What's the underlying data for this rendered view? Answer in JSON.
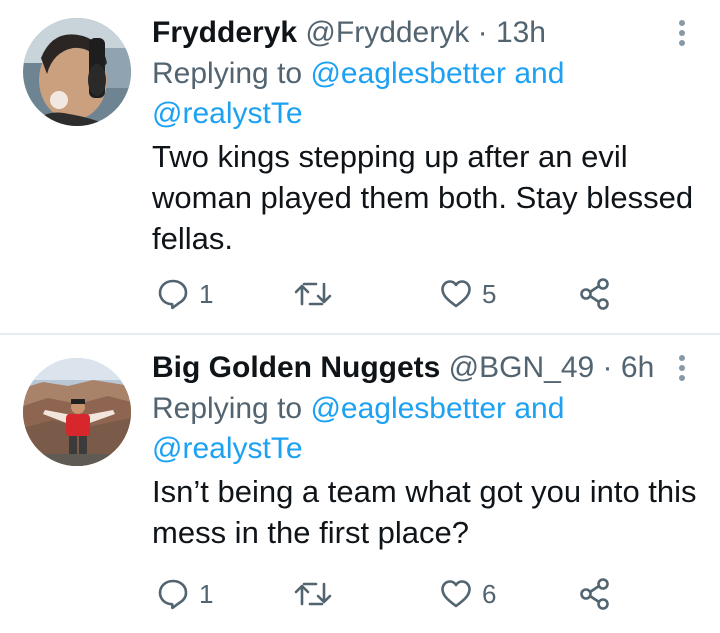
{
  "tweets": [
    {
      "name": "Frydderyk",
      "handle": "@Frydderyk",
      "separator": "·",
      "time": "13h",
      "replying_prefix": "Replying to",
      "mention_1": "@eaglesbetter",
      "and_text": "and",
      "mention_2": "@realystTe",
      "text": "Two kings stepping up after an evil woman played them both. Stay blessed fellas.",
      "reply_count": "1",
      "retweet_count": "",
      "like_count": "5"
    },
    {
      "name": "Big Golden Nuggets",
      "handle": "@BGN_49",
      "separator": "·",
      "time": "6h",
      "replying_prefix": "Replying to",
      "mention_1": "@eaglesbetter",
      "and_text": "and",
      "mention_2": "@realystTe",
      "text": "Isn’t being a team what got you into this mess in the first place?",
      "reply_count": "1",
      "retweet_count": "",
      "like_count": "6"
    }
  ],
  "icons": {
    "reply": "reply-icon",
    "retweet": "retweet-icon",
    "like": "heart-icon",
    "share": "share-icon",
    "more": "more-options-icon"
  },
  "colors": {
    "link": "#1da1f2",
    "secondary_text": "#536471",
    "icon_gray": "#536471",
    "divider": "#e6ecf0"
  }
}
